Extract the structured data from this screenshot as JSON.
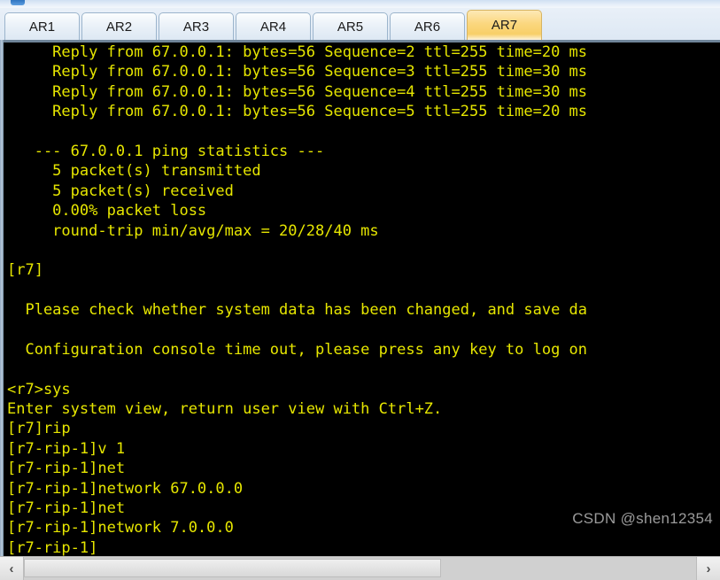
{
  "window": {
    "title": "AR7"
  },
  "tabs": [
    {
      "label": "AR1",
      "active": false
    },
    {
      "label": "AR2",
      "active": false
    },
    {
      "label": "AR3",
      "active": false
    },
    {
      "label": "AR4",
      "active": false
    },
    {
      "label": "AR5",
      "active": false
    },
    {
      "label": "AR6",
      "active": false
    },
    {
      "label": "AR7",
      "active": true
    }
  ],
  "terminal": {
    "lines": [
      "     Reply from 67.0.0.1: bytes=56 Sequence=2 ttl=255 time=20 ms",
      "     Reply from 67.0.0.1: bytes=56 Sequence=3 ttl=255 time=30 ms",
      "     Reply from 67.0.0.1: bytes=56 Sequence=4 ttl=255 time=30 ms",
      "     Reply from 67.0.0.1: bytes=56 Sequence=5 ttl=255 time=20 ms",
      "",
      "   --- 67.0.0.1 ping statistics ---",
      "     5 packet(s) transmitted",
      "     5 packet(s) received",
      "     0.00% packet loss",
      "     round-trip min/avg/max = 20/28/40 ms",
      "",
      "[r7]",
      "",
      "  Please check whether system data has been changed, and save da",
      "",
      "  Configuration console time out, please press any key to log on",
      "",
      "<r7>sys",
      "Enter system view, return user view with Ctrl+Z.",
      "[r7]rip",
      "[r7-rip-1]v 1",
      "[r7-rip-1]net",
      "[r7-rip-1]network 67.0.0.0",
      "[r7-rip-1]net",
      "[r7-rip-1]network 7.0.0.0",
      "[r7-rip-1]"
    ]
  },
  "watermark": {
    "text": "CSDN @shen12354"
  },
  "scrollbar": {
    "left_arrow": "‹",
    "right_arrow": "›"
  },
  "colors": {
    "terminal_background": "#000000",
    "terminal_text": "#e6e600",
    "active_tab": "#fbd77e",
    "tab_background": "#eaf1f8",
    "chrome": "#dfe7f0"
  }
}
